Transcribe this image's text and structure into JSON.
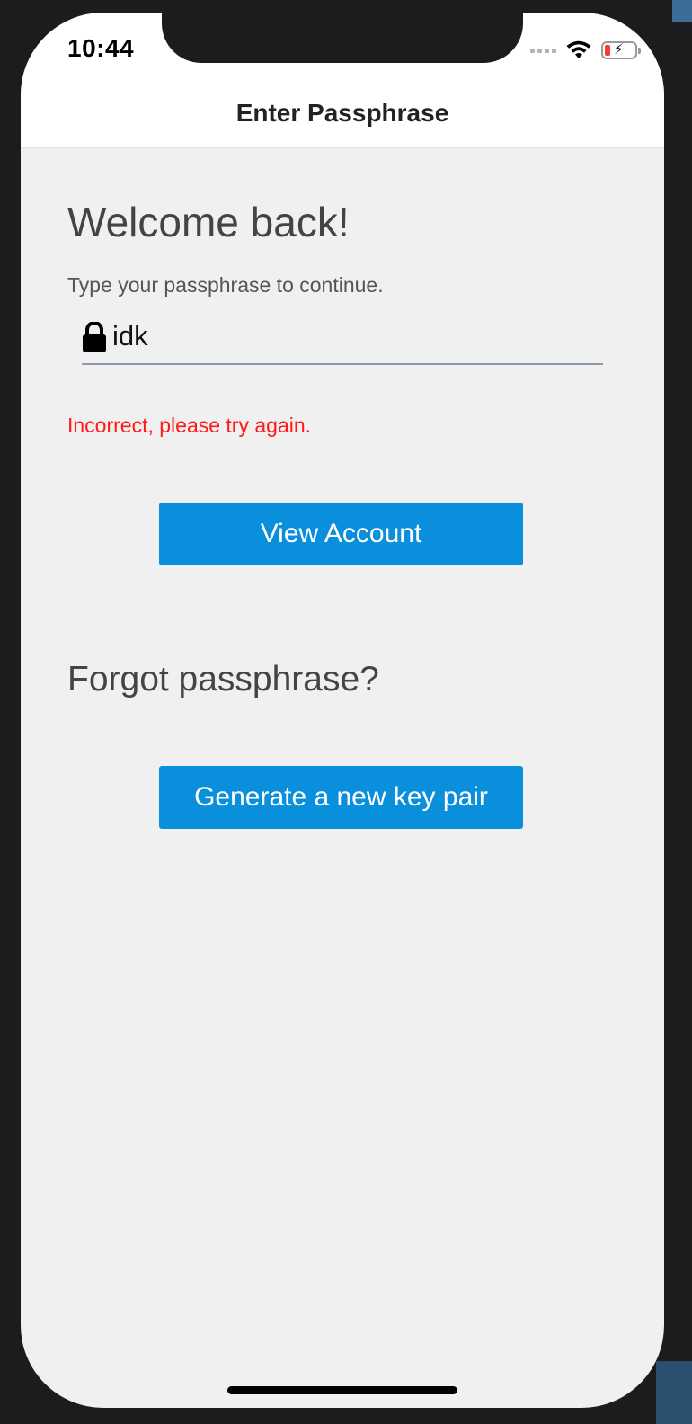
{
  "status_bar": {
    "time": "10:44",
    "icons": [
      "cellular-signal-icon",
      "wifi-icon",
      "battery-charging-icon"
    ],
    "battery_color": "#ff3b30"
  },
  "nav": {
    "title": "Enter Passphrase"
  },
  "main": {
    "heading": "Welcome back!",
    "subtitle": "Type your passphrase to continue.",
    "passphrase_field": {
      "value": "idk",
      "icon": "lock-icon"
    },
    "error_message": "Incorrect, please try again.",
    "view_account_label": "View Account",
    "forgot_heading": "Forgot passphrase?",
    "generate_label": "Generate a new key pair"
  },
  "colors": {
    "accent": "#0a8fdc",
    "error": "#ff1a1a",
    "background": "#f0f0f0"
  }
}
